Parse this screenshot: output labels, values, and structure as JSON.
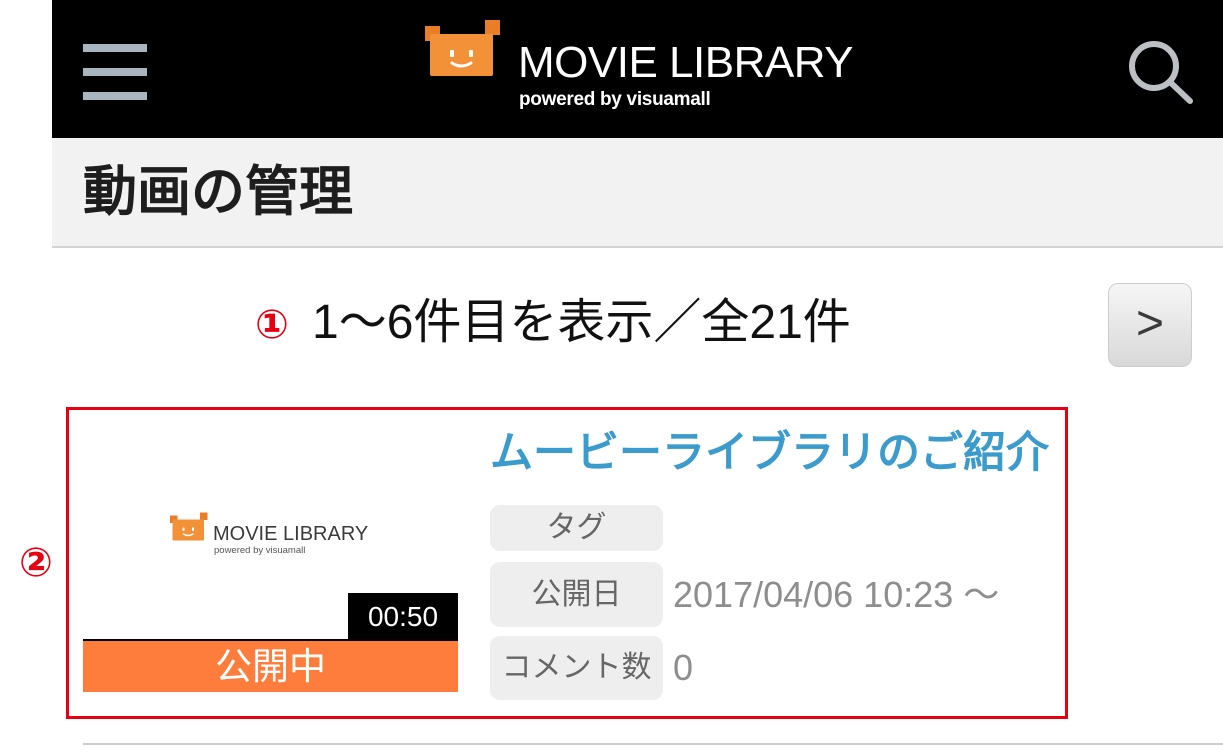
{
  "header": {
    "menu_icon": "hamburger-menu-icon",
    "logo": {
      "icon": "mascot-logo-icon",
      "title": "MOVIE LIBRARY",
      "subtitle": "powered by visuamall"
    },
    "search_icon": "search-icon"
  },
  "page": {
    "title": "動画の管理"
  },
  "pagination": {
    "summary": "1〜6件目を表示／全21件",
    "next_label": ">"
  },
  "annotations": {
    "marker_1": "①",
    "marker_2": "②"
  },
  "videos": [
    {
      "thumbnail": {
        "logo_icon": "mascot-logo-icon",
        "logo_title": "MOVIE LIBRARY",
        "logo_subtitle": "powered by visuamall"
      },
      "duration": "00:50",
      "status": "公開中",
      "title": "ムービーライブラリのご紹介",
      "fields": [
        {
          "label": "タグ"
        },
        {
          "label": "公開日",
          "value": "2017/04/06 10:23 〜"
        },
        {
          "label": "コメント数",
          "value": "0"
        }
      ]
    }
  ],
  "colors": {
    "header_background": "#000000",
    "brand_orange": "#f39139",
    "status_published": "#ff7d3c",
    "video_title": "#3a9bcc",
    "annotation_red": "#e60012",
    "field_label_background": "#eeeeee",
    "field_value_text": "#8e8e8e"
  }
}
